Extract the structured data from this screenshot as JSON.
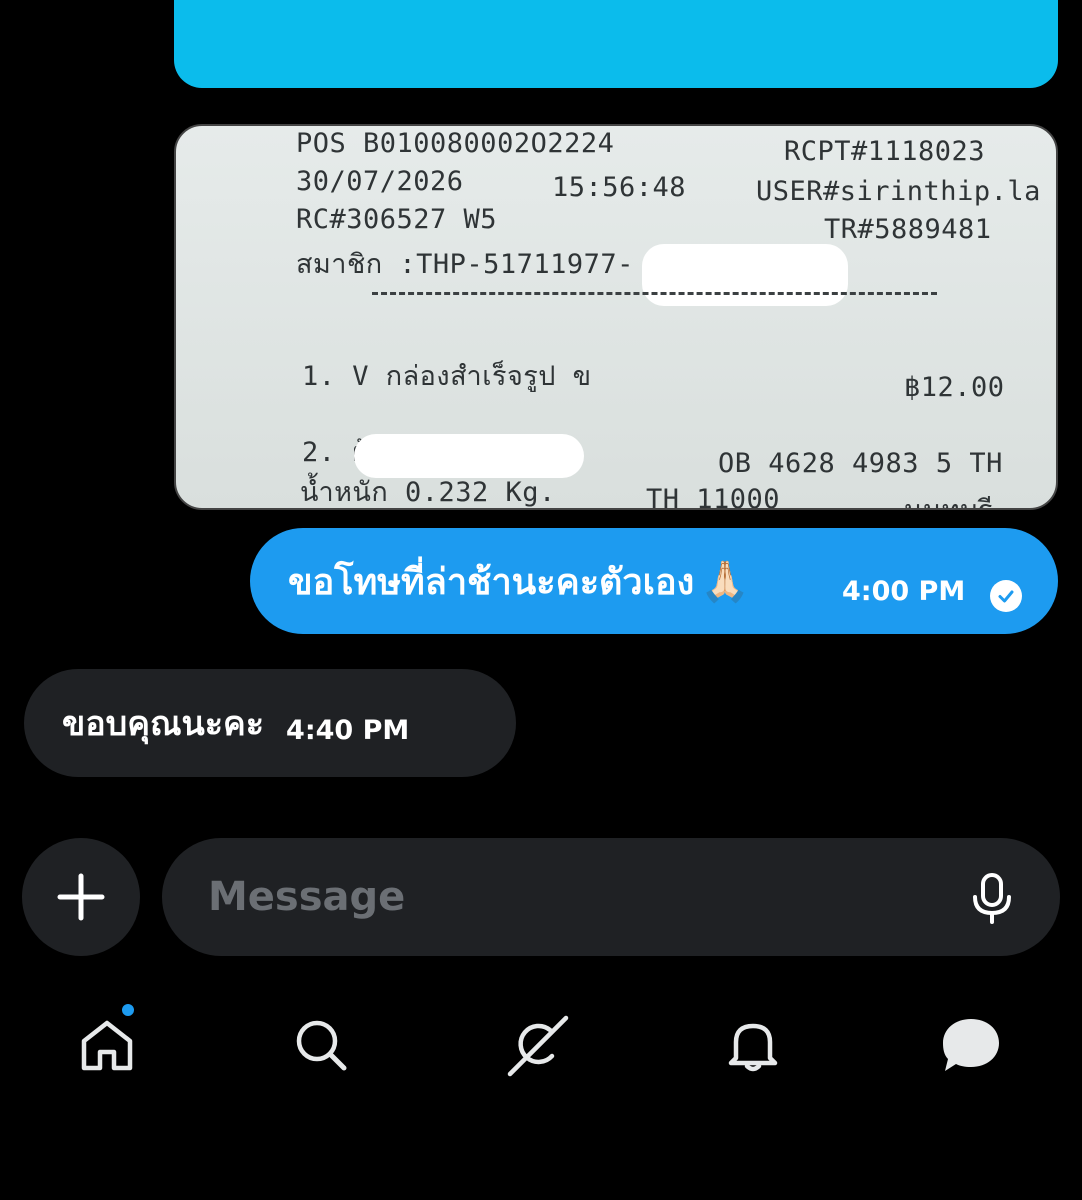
{
  "receipt": {
    "pos": "POS B010080002O2224",
    "rcpt": "RCPT#1118023",
    "date": "30/07/2026",
    "time": "15:56:48",
    "user": "USER#sirinthip.la",
    "rc": "RC#306527 W5",
    "tr": "TR#5889481",
    "member": "สมาชิก :THP-51711977-",
    "item1": "1. V กล่องสำเร็จรูป ข",
    "price1": "฿12.00",
    "item2": "2. ผู้",
    "tracking": "OB 4628 4983 5 TH",
    "weight": "น้ำหนัก  0.232 Kg.",
    "postcode": "TH 11000",
    "province": "นนทบุรี"
  },
  "outgoing": {
    "text": "ขอโทษที่ล่าช้านะคะตัวเอง",
    "emoji": "🙏🏻",
    "time": "4:00 PM"
  },
  "incoming": {
    "text": "ขอบคุณนะคะ",
    "time": "4:40 PM"
  },
  "composer": {
    "placeholder": "Message"
  },
  "colors": {
    "accent": "#1d9bf0",
    "top_bubble": "#0bbcec",
    "bubble_dark": "#1f2124",
    "background": "#000000"
  },
  "nav": {
    "items": [
      "home-icon",
      "search-icon",
      "grok-icon",
      "bell-icon",
      "messages-icon"
    ]
  }
}
